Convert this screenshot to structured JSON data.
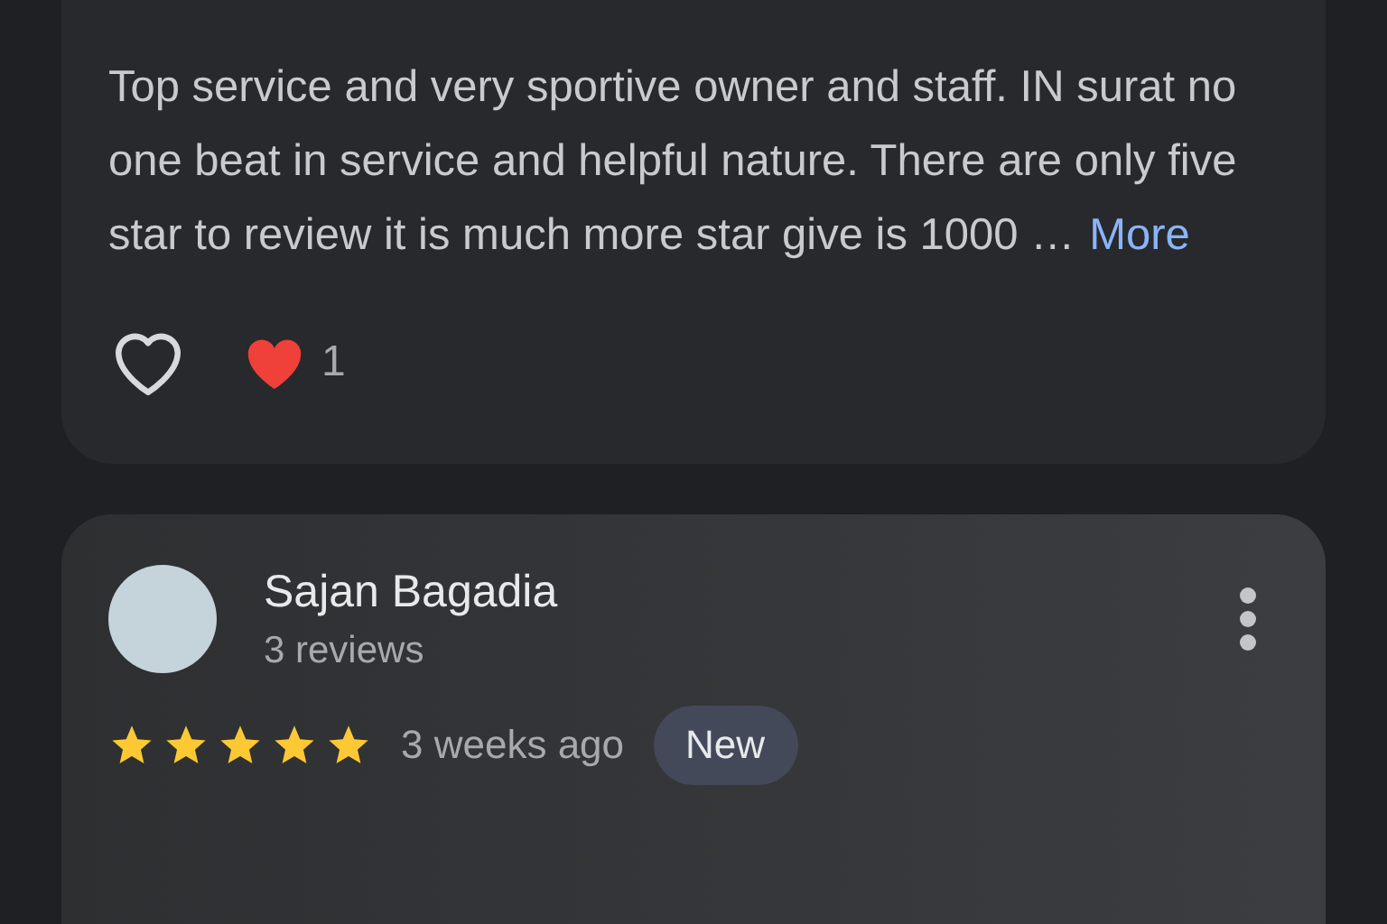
{
  "reviews": [
    {
      "text": "Top service and very sportive owner and staff. IN surat no one beat in service and helpful nature. There are only five star to review it is much more star give is 1000 …",
      "more": "More",
      "reaction_count": "1"
    },
    {
      "name": "Sajan Bagadia",
      "meta": "3 reviews",
      "stars": 5,
      "time": "3 weeks ago",
      "badge": "New"
    }
  ]
}
